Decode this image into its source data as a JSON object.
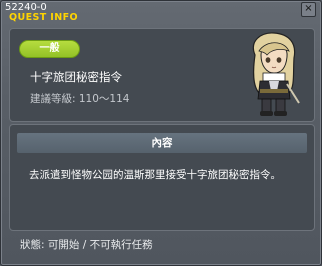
{
  "window": {
    "quest_id": "52240-0",
    "title": "QUEST INFO",
    "close_symbol": "×"
  },
  "quest": {
    "category": "一般",
    "name": "十字旅团秘密指令",
    "level_range": "建議等級: 110～114"
  },
  "content": {
    "header": "內容",
    "description": "去派遣到怪物公园的温斯那里接受十字旅团秘密指令。"
  },
  "status": {
    "text": "狀態:  可開始 / 不可執行任務"
  },
  "icons": {
    "npc": "npc-portrait-icon",
    "close": "close-icon"
  },
  "colors": {
    "title": "#ffd400",
    "badge": "#9fca2f"
  }
}
